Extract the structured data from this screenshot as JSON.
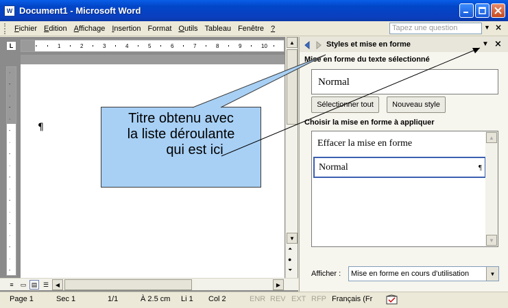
{
  "window": {
    "title": "Document1 - Microsoft Word",
    "icon_text": "W"
  },
  "menu": [
    {
      "label": "Fichier",
      "u": "F",
      "rest": "ichier"
    },
    {
      "label": "Edition",
      "u": "E",
      "rest": "dition"
    },
    {
      "label": "Affichage",
      "u": "A",
      "rest": "ffichage"
    },
    {
      "label": "Insertion",
      "u": "I",
      "rest": "nsertion"
    },
    {
      "label": "Format",
      "u": "",
      "rest": "Format"
    },
    {
      "label": "Outils",
      "u": "O",
      "rest": "utils"
    },
    {
      "label": "Tableau",
      "u": "",
      "rest": "Tableau"
    },
    {
      "label": "Fenêtre",
      "u": "",
      "rest": "Fenêtre"
    },
    {
      "label": "?",
      "u": "?",
      "rest": ""
    }
  ],
  "help_placeholder": "Tapez une question",
  "document": {
    "paragraph_mark": "¶"
  },
  "task_pane": {
    "title": "Styles et mise en forme",
    "selected_text_label": "Mise en forme du texte sélectionné",
    "current_style": "Normal",
    "select_all_button": "Sélectionner tout",
    "new_style_button": "Nouveau style",
    "choose_label": "Choisir la mise en forme à appliquer",
    "list": [
      {
        "label": "Effacer la mise en forme"
      },
      {
        "label": "Normal",
        "mark": "¶"
      }
    ],
    "show_label": "Afficher :",
    "show_value": "Mise en forme en cours d'utilisation"
  },
  "callout": {
    "line1": "Titre obtenu avec",
    "line2": "la liste déroulante",
    "line3": "qui est ici"
  },
  "status": {
    "page": "Page  1",
    "sec": "Sec  1",
    "pages": "1/1",
    "at": "À  2.5 cm",
    "line": "Li  1",
    "col": "Col  2",
    "enr": "ENR",
    "rev": "REV",
    "ext": "EXT",
    "rfp": "RFP",
    "lang": "Français (Fr"
  },
  "colors": {
    "callout_fill": "#a8d0f5",
    "title_bar": "#0246c8"
  }
}
